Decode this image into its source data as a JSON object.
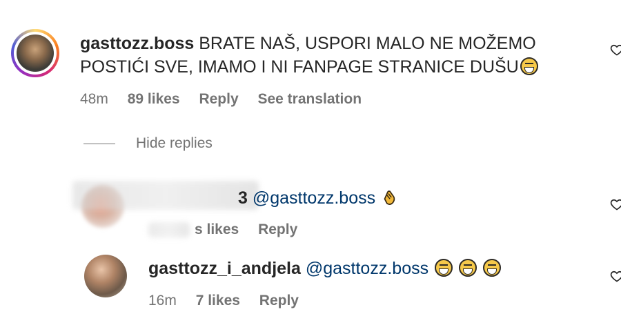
{
  "comments": [
    {
      "username": "gasttozz.boss",
      "text_line1": "BRATE NAŠ, USPORI MALO NE MOŽEMO",
      "text_line2": "POSTIĆI SVE, IMAMO I NI FANPAGE STRANICE DUŠU",
      "emoji": "face-with-tears-of-joy",
      "time": "48m",
      "likes": "89 likes",
      "reply": "Reply",
      "see_translation": "See translation"
    },
    {
      "username_partial": "3",
      "mention": "@gasttozz.boss",
      "emoji": "clapping-hands",
      "likes_partial": "s likes",
      "reply": "Reply"
    },
    {
      "username": "gasttozz_i_andjela",
      "mention": "@gasttozz.boss",
      "emoji": "face-with-tears-of-joy x3",
      "time": "16m",
      "likes": "7 likes",
      "reply": "Reply"
    }
  ],
  "hide_replies": "Hide replies",
  "colors": {
    "text": "#262626",
    "meta": "#737373",
    "mention": "#00376b"
  }
}
